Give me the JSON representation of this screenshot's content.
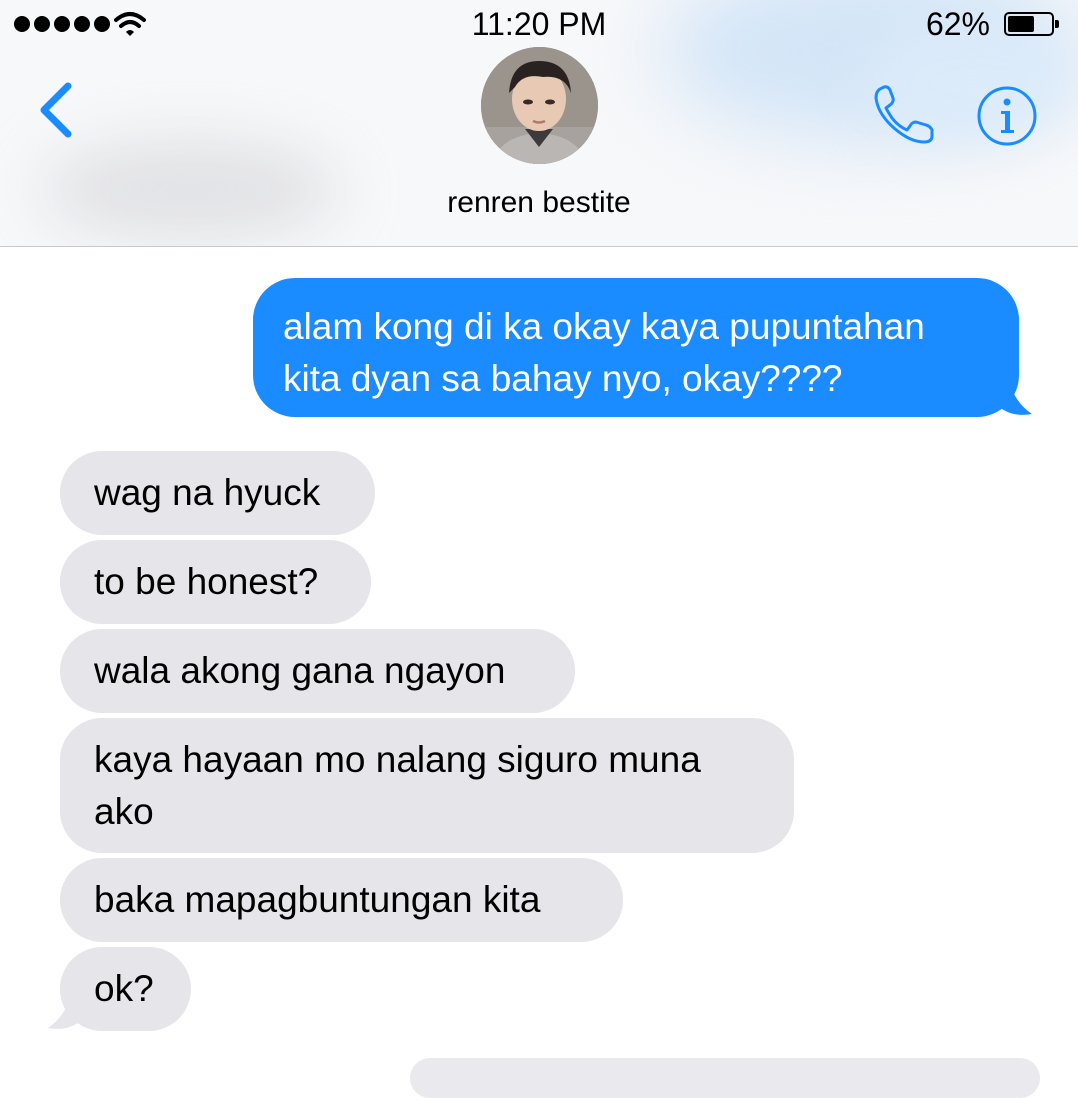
{
  "status_bar": {
    "time": "11:20 PM",
    "battery_percent": "62%",
    "battery_level": 0.62,
    "signal_dots": 5
  },
  "header": {
    "contact_name": "renren bestite",
    "back_icon": "chevron-left-icon",
    "call_icon": "phone-icon",
    "info_icon": "info-icon"
  },
  "colors": {
    "accent": "#1a8cff",
    "received_bubble": "#e5e5ea"
  },
  "messages": [
    {
      "direction": "sent",
      "text": "alam kong di ka okay kaya pupuntahan kita dyan sa bahay nyo, okay????"
    },
    {
      "direction": "received",
      "text": "wag na hyuck"
    },
    {
      "direction": "received",
      "text": "to be honest?"
    },
    {
      "direction": "received",
      "text": "wala akong gana ngayon"
    },
    {
      "direction": "received",
      "text": "kaya hayaan mo nalang siguro muna ako"
    },
    {
      "direction": "received",
      "text": "baka mapagbuntungan kita"
    },
    {
      "direction": "received",
      "text": "ok?"
    }
  ]
}
